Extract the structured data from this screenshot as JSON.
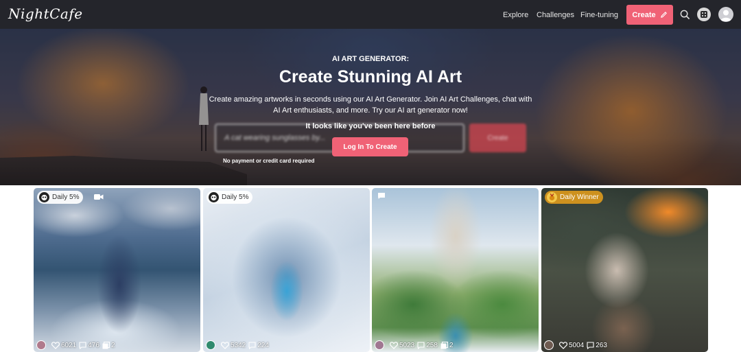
{
  "nav": {
    "logo": "NightCafe",
    "links": [
      {
        "label": "Explore"
      },
      {
        "label": "Challenges"
      },
      {
        "label": "Fine-tuning"
      }
    ],
    "create_label": "Create",
    "icons": [
      "search-icon",
      "dice-icon",
      "avatar"
    ]
  },
  "hero": {
    "kicker": "AI ART GENERATOR:",
    "title": "Create Stunning AI Art",
    "description": "Create amazing artworks in seconds using our AI Art Generator. Join AI Art Challenges, chat with AI Art enthusiasts, and more. Try our AI art generator now!",
    "prompt_placeholder": "A cat wearing sunglasses by...",
    "blurred_create_label": "Create",
    "notice": "It looks like you've been here before",
    "login_label": "Log In To Create",
    "no_payment": "No payment or credit card required"
  },
  "gallery": [
    {
      "badge": "Daily 5%",
      "badge_style": "dark",
      "has_video_icon": true,
      "likes": "6021",
      "comments": "476",
      "images": "2"
    },
    {
      "badge": "Daily 5%",
      "badge_style": "dark",
      "has_video_icon": false,
      "likes": "5342",
      "comments": "224",
      "images": ""
    },
    {
      "badge": "",
      "badge_style": "none",
      "has_video_icon": false,
      "has_chat_icon": true,
      "likes": "5023",
      "comments": "258",
      "images": "2"
    },
    {
      "badge": "Daily Winner",
      "badge_style": "gold",
      "has_video_icon": false,
      "likes": "5004",
      "comments": "263",
      "images": ""
    }
  ],
  "colors": {
    "nav_bg": "#24252b",
    "accent": "#f06276",
    "gold_badge": "#d6961e"
  }
}
